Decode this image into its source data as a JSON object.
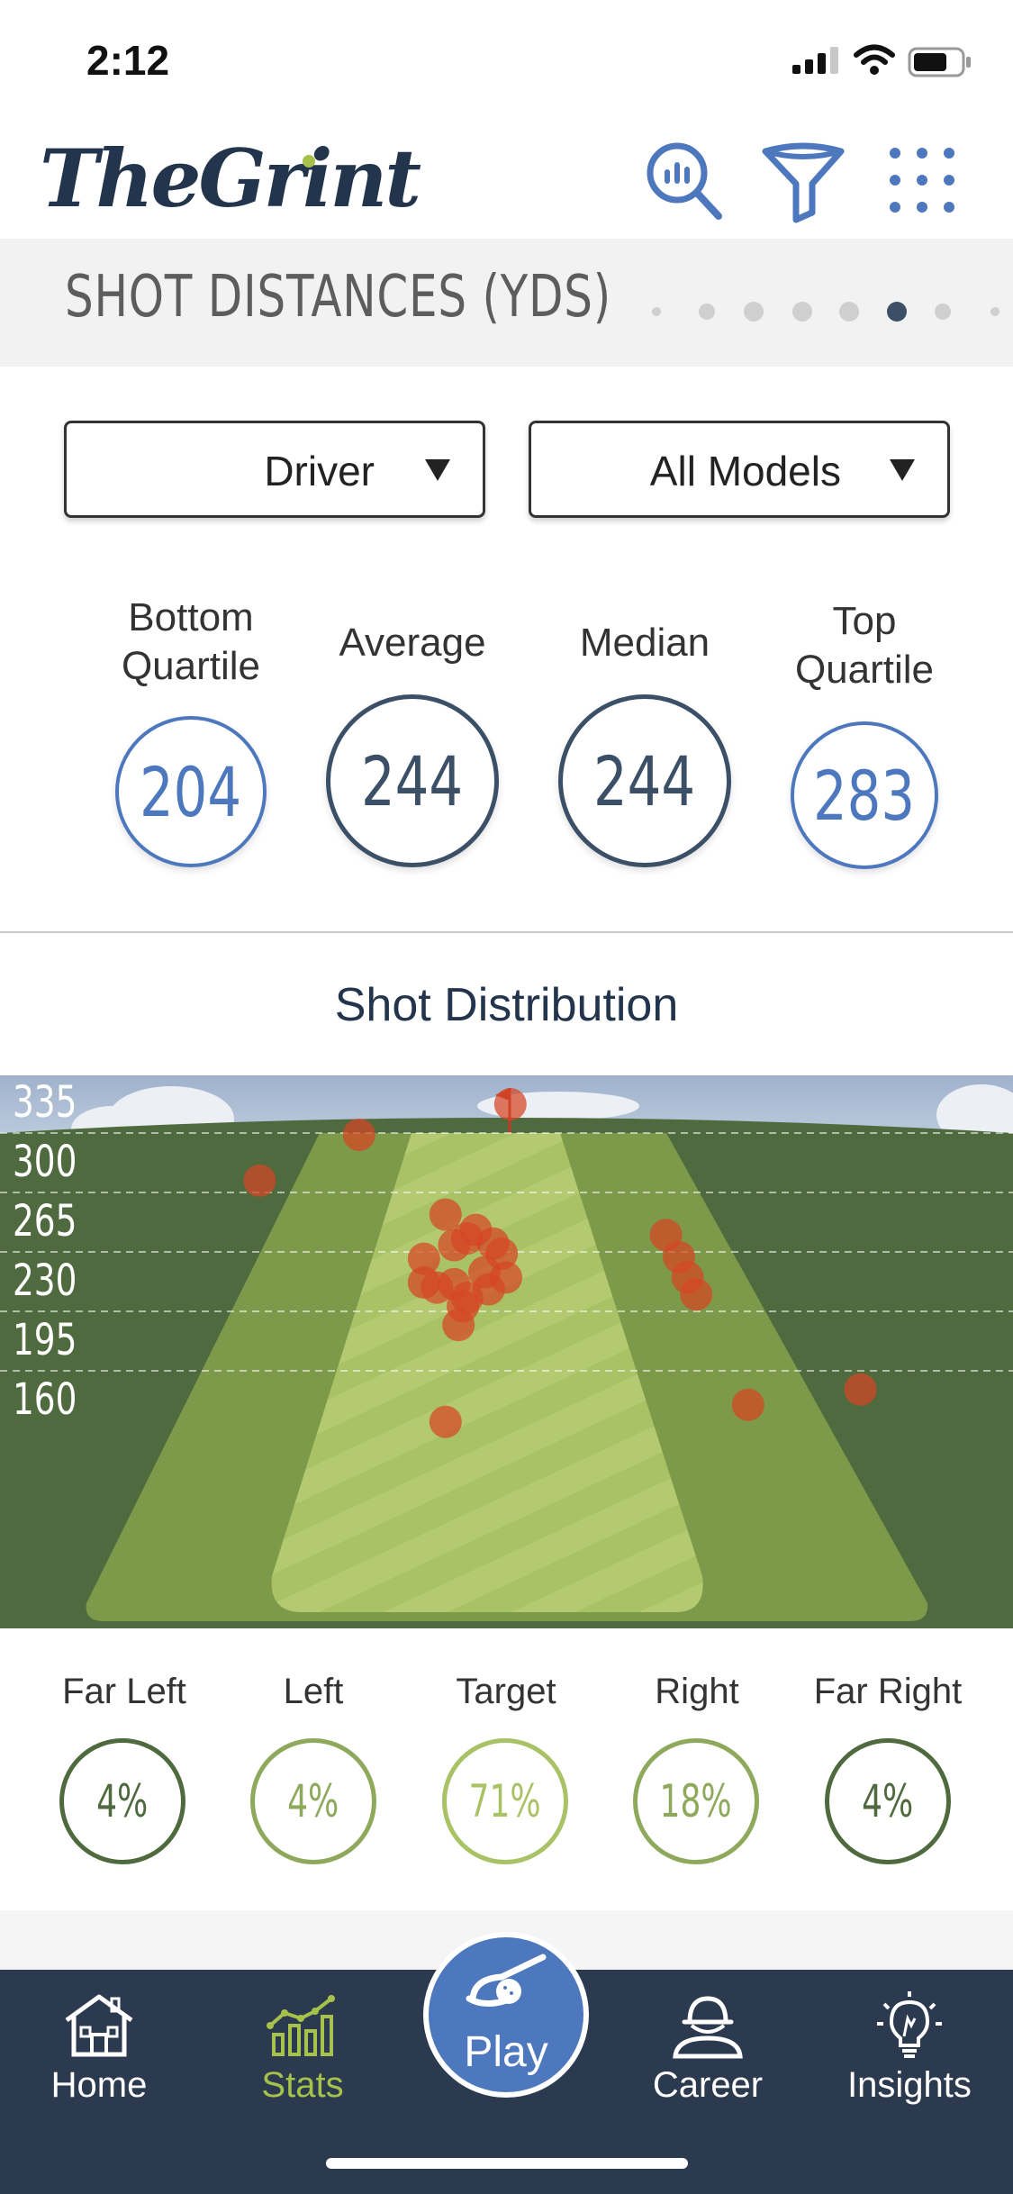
{
  "status": {
    "time": "2:12"
  },
  "header": {
    "logo": "TheGrint"
  },
  "section": {
    "title": "SHOT DISTANCES (YDS)",
    "page_count": 8,
    "active_page": 6
  },
  "filters": {
    "club": "Driver",
    "model": "All Models"
  },
  "stats": [
    {
      "label_lines": [
        "Bottom",
        "Quartile"
      ],
      "value": "204",
      "color": "#4d78bd"
    },
    {
      "label_lines": [
        "Average"
      ],
      "value": "244",
      "color": "#3b4f66"
    },
    {
      "label_lines": [
        "Median"
      ],
      "value": "244",
      "color": "#3b4f66"
    },
    {
      "label_lines": [
        "Top",
        "Quartile"
      ],
      "value": "283",
      "color": "#4d78bd"
    }
  ],
  "distribution": {
    "title": "Shot Distribution"
  },
  "chart_data": {
    "type": "scatter",
    "title": "",
    "y_ticks": [
      335,
      300,
      265,
      230,
      195,
      160
    ],
    "ylim": [
      160,
      335
    ],
    "xlim": [
      -1,
      1
    ],
    "colors": {
      "sky": "#b8c7db",
      "rough": "#4f6a3e",
      "fairway_outer": "#7d9a4a",
      "fairway_center": "#a9c265",
      "shot": "#d64524",
      "flag": "#c0392b"
    },
    "points": [
      {
        "x": 0.01,
        "y": 335
      },
      {
        "x": -0.34,
        "y": 317
      },
      {
        "x": -0.57,
        "y": 290
      },
      {
        "x": -0.14,
        "y": 270
      },
      {
        "x": -0.07,
        "y": 261
      },
      {
        "x": -0.09,
        "y": 256
      },
      {
        "x": -0.12,
        "y": 252
      },
      {
        "x": -0.03,
        "y": 253
      },
      {
        "x": -0.01,
        "y": 247
      },
      {
        "x": -0.19,
        "y": 244
      },
      {
        "x": -0.05,
        "y": 236
      },
      {
        "x": 0.0,
        "y": 233
      },
      {
        "x": -0.19,
        "y": 230
      },
      {
        "x": -0.16,
        "y": 227
      },
      {
        "x": -0.12,
        "y": 229
      },
      {
        "x": -0.04,
        "y": 226
      },
      {
        "x": -0.09,
        "y": 221
      },
      {
        "x": -0.1,
        "y": 216
      },
      {
        "x": -0.11,
        "y": 205
      },
      {
        "x": 0.37,
        "y": 258
      },
      {
        "x": 0.4,
        "y": 245
      },
      {
        "x": 0.42,
        "y": 233
      },
      {
        "x": 0.44,
        "y": 223
      },
      {
        "x": 0.82,
        "y": 167
      },
      {
        "x": 0.56,
        "y": 158
      },
      {
        "x": -0.14,
        "y": 148
      }
    ]
  },
  "directions": [
    {
      "label": "Far Left",
      "value": "4%",
      "color": "#4f6a3e"
    },
    {
      "label": "Left",
      "value": "4%",
      "color": "#8ea85c"
    },
    {
      "label": "Target",
      "value": "71%",
      "color": "#a9c265"
    },
    {
      "label": "Right",
      "value": "18%",
      "color": "#8ea85c"
    },
    {
      "label": "Far Right",
      "value": "4%",
      "color": "#4f6a3e"
    }
  ],
  "nav": {
    "home": "Home",
    "stats": "Stats",
    "play": "Play",
    "career": "Career",
    "insights": "Insights",
    "active_color": "#a6c24a"
  }
}
